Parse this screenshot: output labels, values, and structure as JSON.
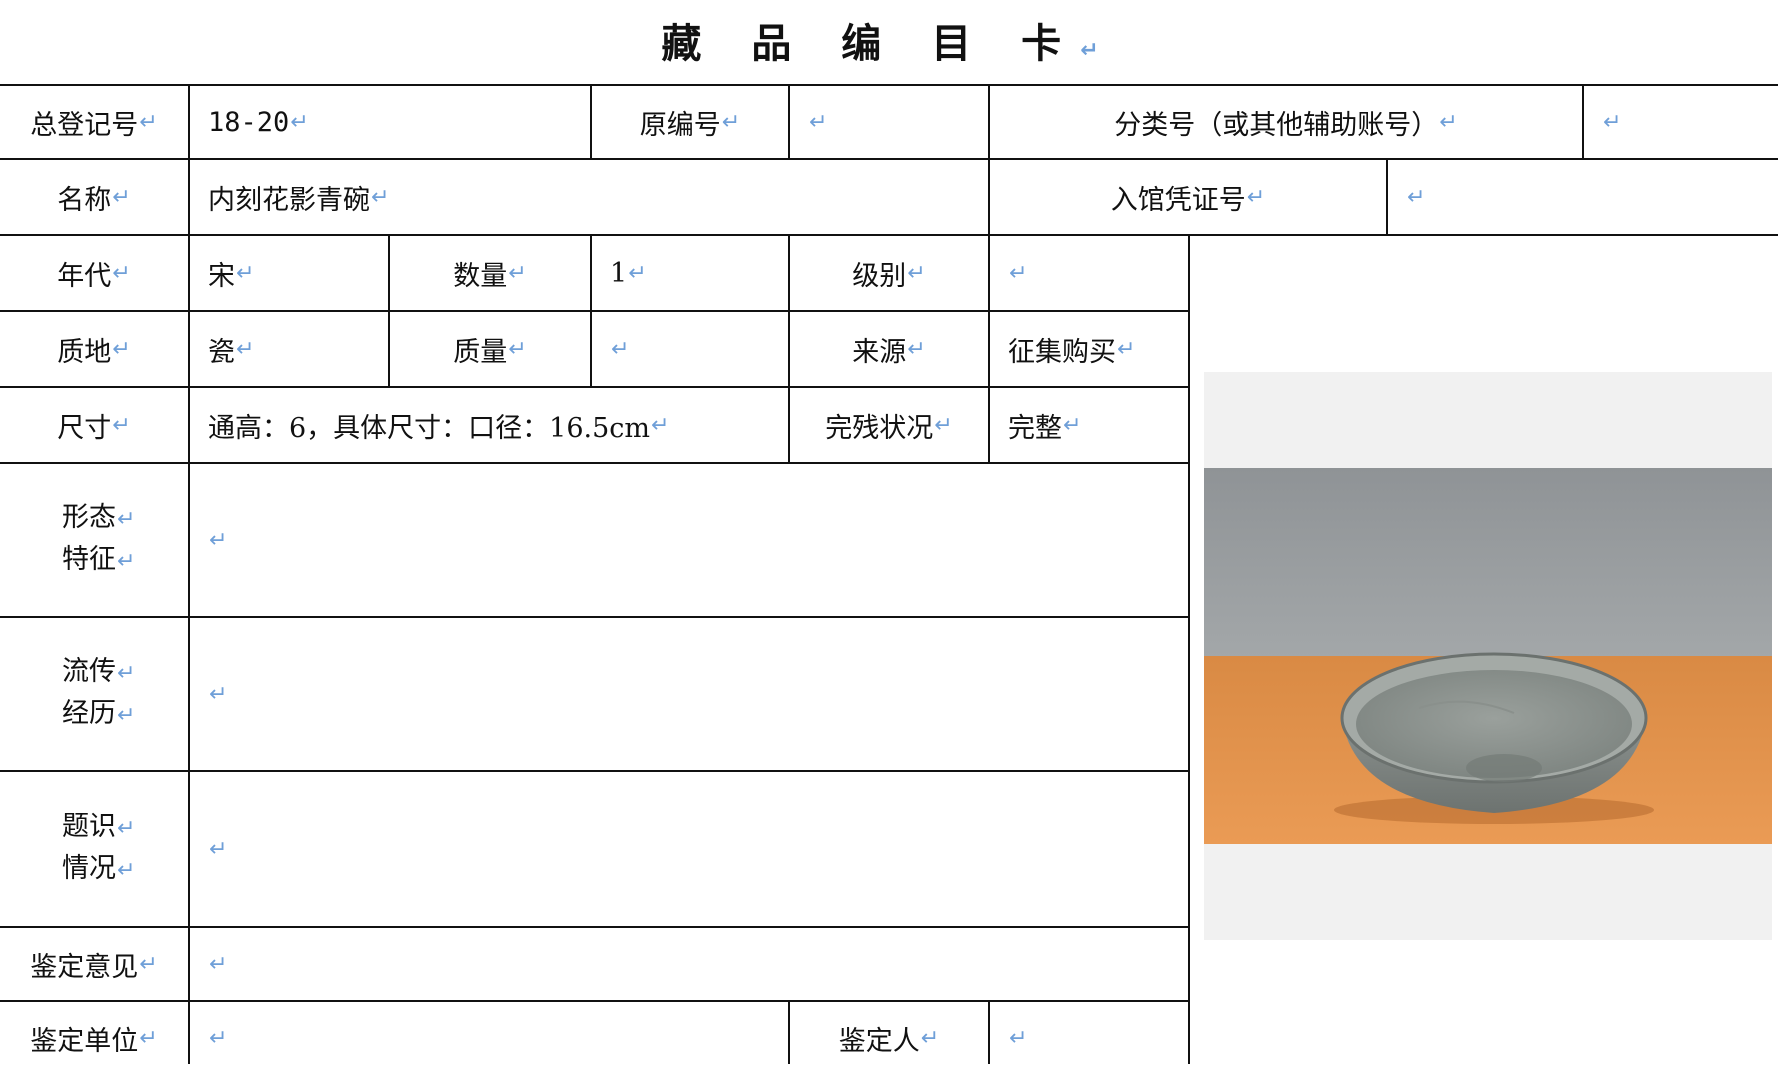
{
  "title": "藏 品 编 目 卡",
  "return_mark": "↵",
  "labels": {
    "total_reg_no": "总登记号",
    "original_no": "原编号",
    "category_no": "分类号（或其他辅助账号）",
    "name": "名称",
    "entry_voucher_no": "入馆凭证号",
    "era": "年代",
    "quantity": "数量",
    "grade": "级别",
    "material": "质地",
    "weight": "质量",
    "source": "来源",
    "size": "尺寸",
    "condition": "完残状况",
    "form_features": [
      "形态",
      "特征"
    ],
    "provenance": [
      "流传",
      "经历"
    ],
    "inscription": [
      "题识",
      "情况"
    ],
    "appraisal_opinion": "鉴定意见",
    "appraisal_unit": "鉴定单位",
    "appraiser": "鉴定人"
  },
  "values": {
    "total_reg_no": "18-20",
    "name": "内刻花影青碗",
    "era": "宋",
    "quantity": "1",
    "material": "瓷",
    "source": "征集购买",
    "size": "通高：6，具体尺寸：口径：16.5cm",
    "condition": "完整"
  },
  "colors": {
    "border": "#111111",
    "return_mark": "#6f9fd8",
    "photo_background": "#f1f1f1"
  }
}
